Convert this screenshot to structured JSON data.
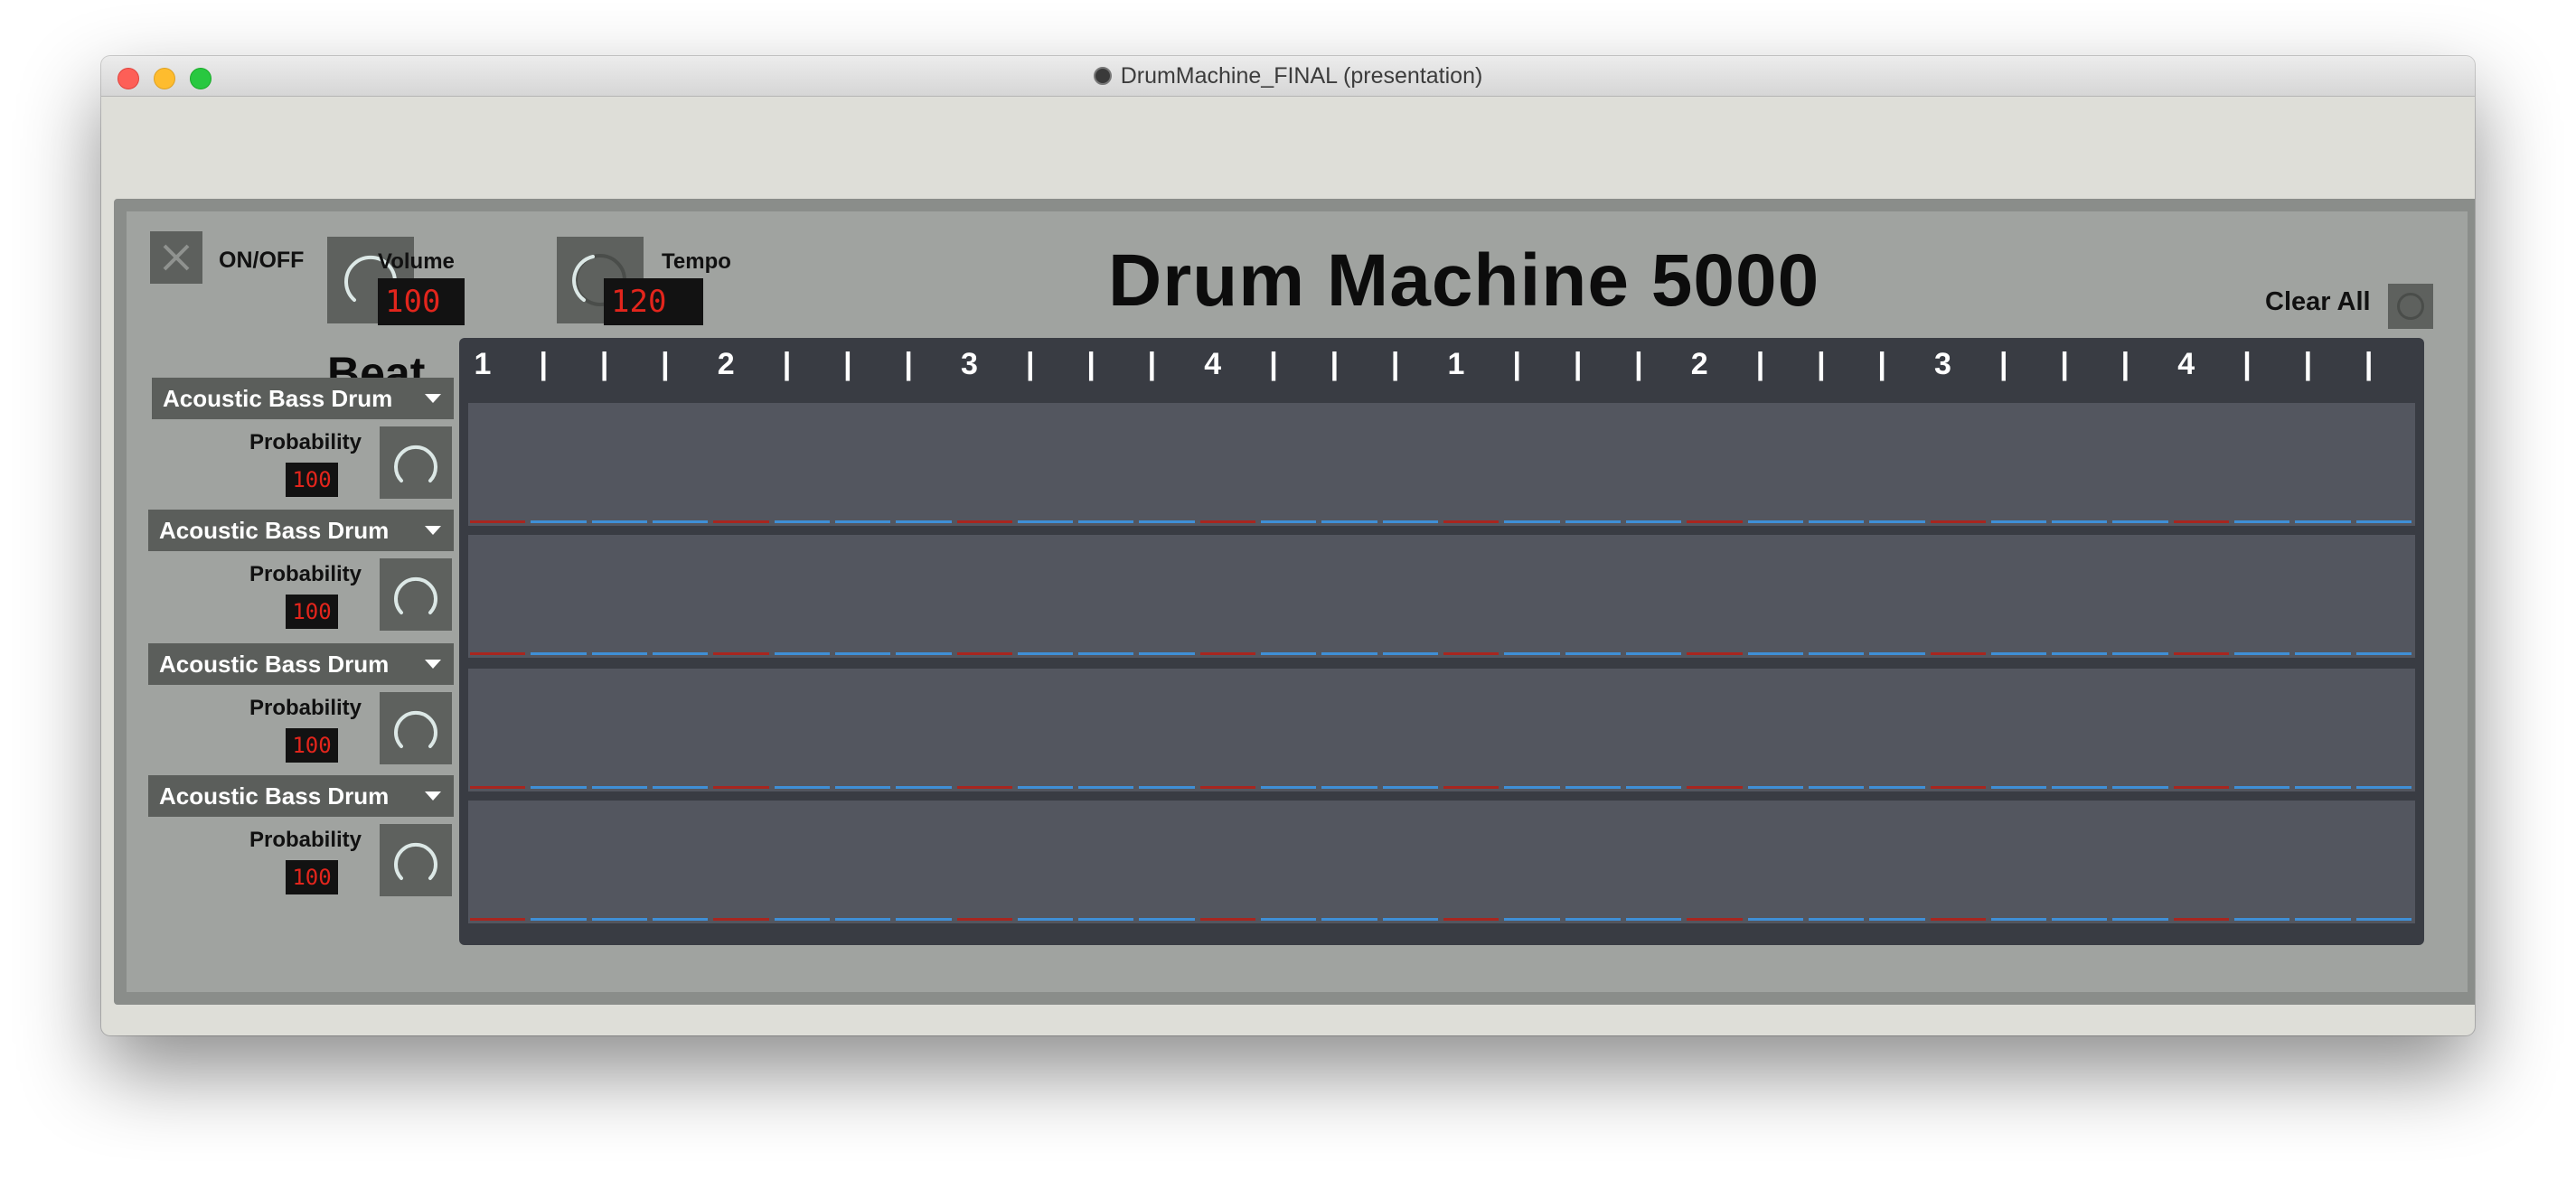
{
  "window": {
    "title": "DrumMachine_FINAL (presentation)"
  },
  "controls": {
    "onoff_label": "ON/OFF",
    "volume_label": "Volume",
    "volume_value": "100",
    "tempo_label": "Tempo",
    "tempo_value": "120",
    "clear_all_label": "Clear All"
  },
  "app_title": "Drum Machine 5000",
  "beat_label": "Beat",
  "beat_header": [
    "1",
    "|",
    "|",
    "|",
    "2",
    "|",
    "|",
    "|",
    "3",
    "|",
    "|",
    "|",
    "4",
    "|",
    "|",
    "|",
    "1",
    "|",
    "|",
    "|",
    "2",
    "|",
    "|",
    "|",
    "3",
    "|",
    "|",
    "|",
    "4",
    "|",
    "|",
    "|"
  ],
  "tracks": [
    {
      "instrument": "Acoustic Bass Drum",
      "probability_label": "Probability",
      "probability_value": "100"
    },
    {
      "instrument": "Acoustic Bass Drum",
      "probability_label": "Probability",
      "probability_value": "100"
    },
    {
      "instrument": "Acoustic Bass Drum",
      "probability_label": "Probability",
      "probability_value": "100"
    },
    {
      "instrument": "Acoustic Bass Drum",
      "probability_label": "Probability",
      "probability_value": "100"
    }
  ],
  "steps_per_row": 32,
  "colors": {
    "downbeat_step": "#a8261f",
    "offbeat_step": "#3f8fd6",
    "number_display": "#e2251c",
    "grid_background": "#393c43",
    "row_background": "#53565f"
  }
}
